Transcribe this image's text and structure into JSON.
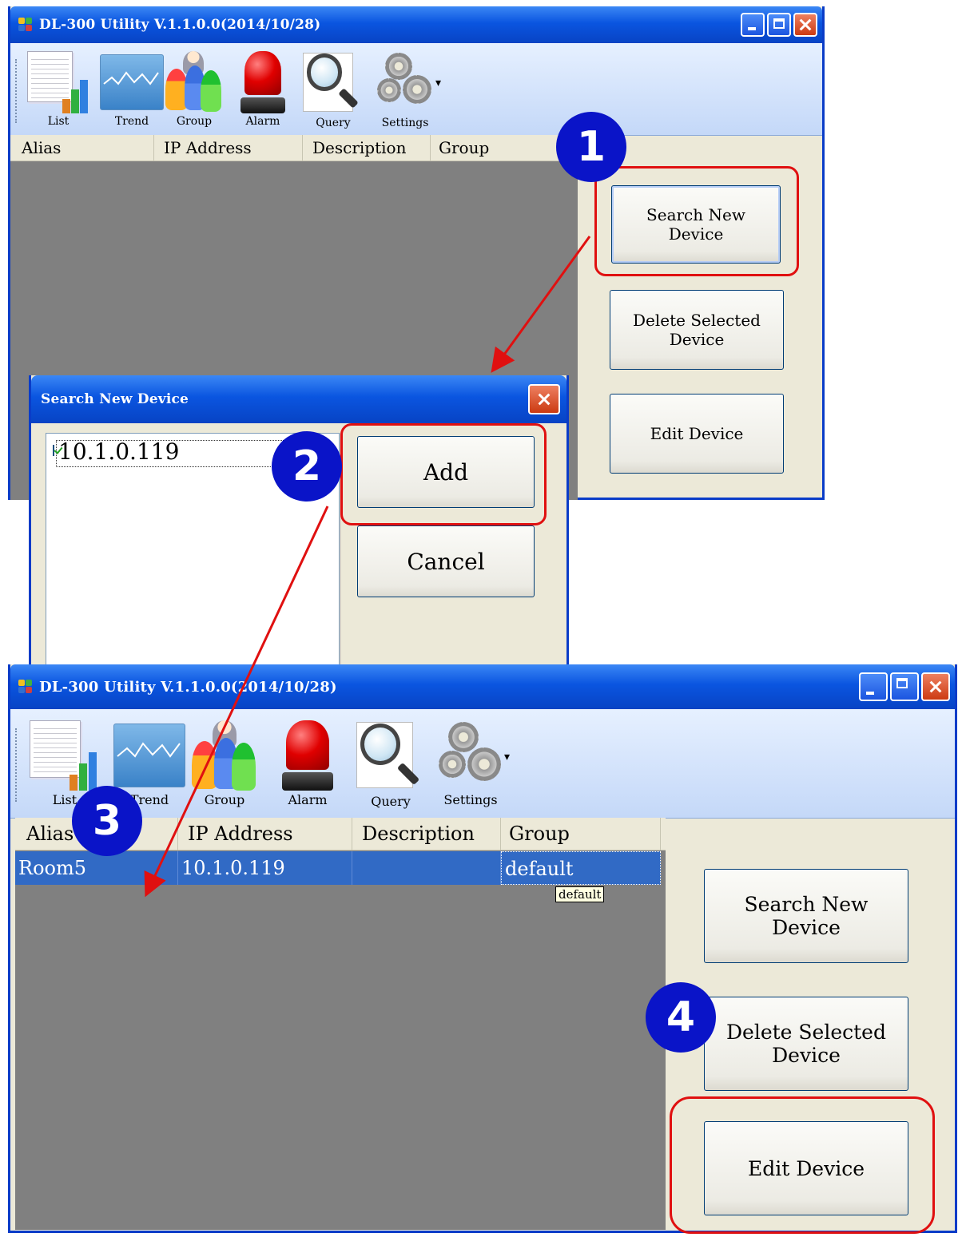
{
  "main_window": {
    "title": "DL-300 Utility V.1.1.0.0(2014/10/28)",
    "toolbar": [
      {
        "label": "List",
        "icon": "list-icon"
      },
      {
        "label": "Trend",
        "icon": "trend-icon"
      },
      {
        "label": "Group",
        "icon": "group-icon"
      },
      {
        "label": "Alarm",
        "icon": "alarm-icon"
      },
      {
        "label": "Query",
        "icon": "query-icon"
      },
      {
        "label": "Settings",
        "icon": "settings-icon"
      }
    ],
    "dropdown_caret": "▾",
    "columns": [
      "Alias",
      "IP Address",
      "Description",
      "Group"
    ],
    "buttons": {
      "search": "Search New Device",
      "delete": "Delete Selected Device",
      "edit": "Edit Device"
    }
  },
  "dialog": {
    "title": "Search New Device",
    "found_devices": [
      {
        "ip": "10.1.0.119",
        "checked": true
      }
    ],
    "add_label": "Add",
    "cancel_label": "Cancel"
  },
  "result_window": {
    "title": "DL-300 Utility V.1.1.0.0(2014/10/28)",
    "columns": [
      "Alias",
      "IP Address",
      "Description",
      "Group"
    ],
    "rows": [
      {
        "alias": "Room5",
        "ip": "10.1.0.119",
        "description": "",
        "group": "default"
      }
    ],
    "tooltip": "default"
  },
  "steps": [
    "1",
    "2",
    "3",
    "4"
  ],
  "colors": {
    "badge": "#0a14c8",
    "highlight": "#e01010",
    "titlebar": "#0a55e0",
    "selection": "#316ac5"
  }
}
